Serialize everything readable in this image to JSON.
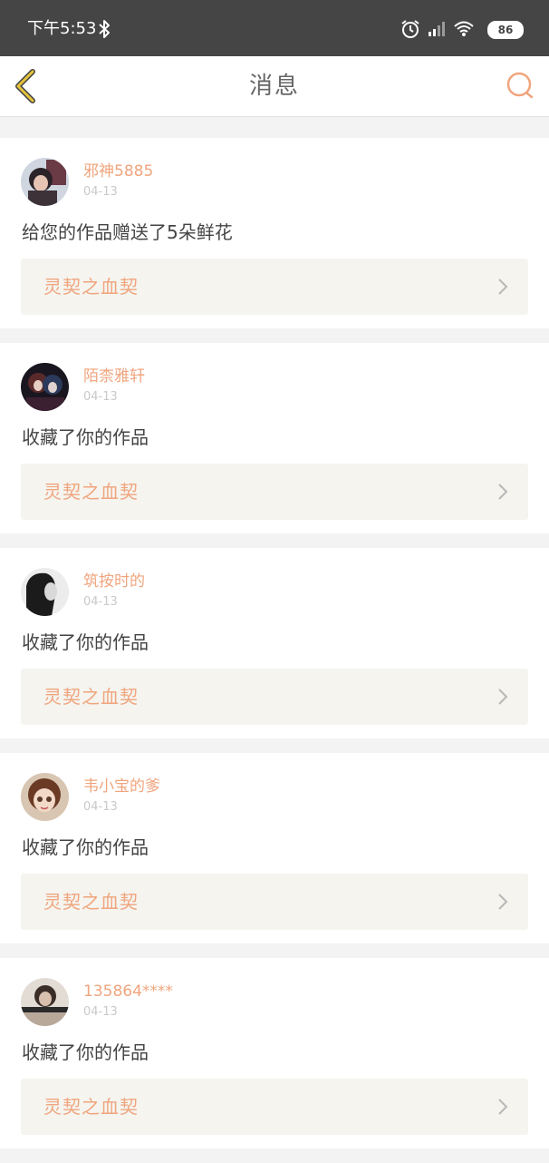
{
  "status_bar": {
    "time": "下午5:53",
    "battery": "86",
    "icons": [
      "bluetooth-icon",
      "alarm-icon",
      "signal-icon",
      "wifi-icon",
      "battery-icon"
    ]
  },
  "header": {
    "title": "消息",
    "back_icon": "chevron-left-icon",
    "search_icon": "search-icon"
  },
  "colors": {
    "accent": "#f0a57e",
    "back_icon": "#e7c43a",
    "status_bar_bg": "#454545",
    "work_link_bg": "#f5f4ef"
  },
  "messages": [
    {
      "username": "邪神5885",
      "date": "04-13",
      "text": "给您的作品赠送了5朵鲜花",
      "work_title": "灵契之血契"
    },
    {
      "username": "陌柰雅轩",
      "date": "04-13",
      "text": "收藏了你的作品",
      "work_title": "灵契之血契"
    },
    {
      "username": "筑按时的",
      "date": "04-13",
      "text": "收藏了你的作品",
      "work_title": "灵契之血契"
    },
    {
      "username": "韦小宝的爹",
      "date": "04-13",
      "text": "收藏了你的作品",
      "work_title": "灵契之血契"
    },
    {
      "username": "135864****",
      "date": "04-13",
      "text": "收藏了你的作品",
      "work_title": "灵契之血契"
    }
  ]
}
